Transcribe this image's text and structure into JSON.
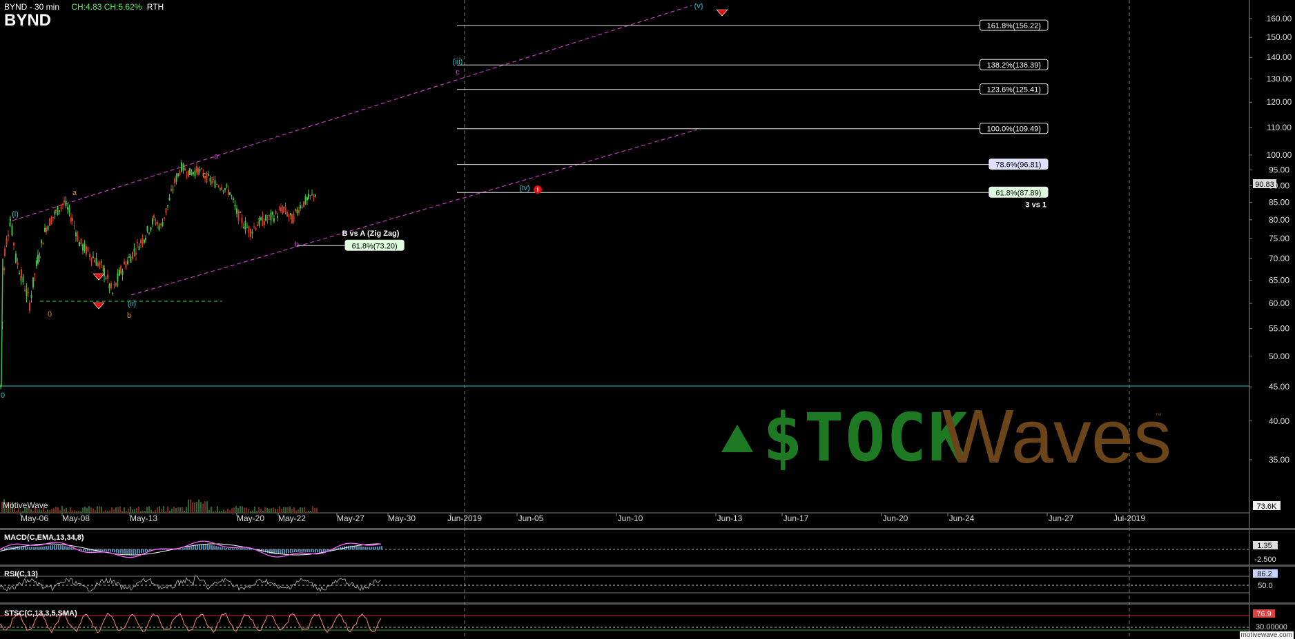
{
  "header": {
    "title": "BYND - 30 min",
    "change": "CH:4.83 CH:5.62%",
    "session": "RTH",
    "symbol": "BYND"
  },
  "vendor": "MotiveWave",
  "watermark": "motivewave.com",
  "logo": {
    "stock": "$TOCK",
    "waves": "Waves",
    "tm": "™"
  },
  "colors": {
    "background": "#000000",
    "bull": "#3fc43f",
    "bear": "#d83a1e",
    "channel": "#c23cc2",
    "fib": "#ffffff",
    "wave_cyan": "#2cc4d0",
    "wave_orange": "#e08a2a",
    "wave_magenta": "#d040d0",
    "macd_line": "#ff66ff",
    "macd_signal": "#ffffff",
    "macd_hist": "#5ab0e0",
    "rsi_line": "#bbbbbb",
    "stoch_line": "#ff8080",
    "logo_green": "#1d7a22",
    "logo_brown": "#6b4519"
  },
  "chart_data": {
    "type": "candlestick",
    "title": "BYND - 30 min",
    "x_ticks": [
      "May-06",
      "May-08",
      "May-13",
      "May-20",
      "May-22",
      "May-27",
      "May-30",
      "Jun-2019",
      "Jun-05",
      "Jun-10",
      "Jun-13",
      "Jun-17",
      "Jun-20",
      "Jun-24",
      "Jun-27",
      "Jul-2019"
    ],
    "y_ticks": [
      35,
      40,
      45,
      50,
      55,
      60,
      65,
      70,
      75,
      80,
      85,
      90,
      95,
      100,
      110,
      120,
      130,
      140,
      150,
      160
    ],
    "ylim": [
      32,
      164
    ],
    "y_scale": "log",
    "last_price": "90.83",
    "volume_label": "73.6K",
    "price_path": [
      [
        0,
        45
      ],
      [
        6,
        72
      ],
      [
        14,
        80
      ],
      [
        22,
        70
      ],
      [
        30,
        66
      ],
      [
        42,
        60
      ],
      [
        54,
        70
      ],
      [
        66,
        78
      ],
      [
        80,
        82
      ],
      [
        92,
        85
      ],
      [
        104,
        80
      ],
      [
        114,
        74
      ],
      [
        124,
        72
      ],
      [
        136,
        70
      ],
      [
        150,
        67
      ],
      [
        162,
        62
      ],
      [
        174,
        67
      ],
      [
        186,
        70
      ],
      [
        198,
        73
      ],
      [
        210,
        76
      ],
      [
        222,
        80
      ],
      [
        232,
        78
      ],
      [
        242,
        84
      ],
      [
        252,
        91
      ],
      [
        262,
        96
      ],
      [
        274,
        94
      ],
      [
        286,
        95
      ],
      [
        296,
        93
      ],
      [
        308,
        91
      ],
      [
        320,
        90
      ],
      [
        332,
        88
      ],
      [
        342,
        82
      ],
      [
        352,
        79
      ],
      [
        362,
        77
      ],
      [
        372,
        79
      ],
      [
        384,
        80
      ],
      [
        396,
        81
      ],
      [
        410,
        83
      ],
      [
        422,
        80
      ],
      [
        434,
        84
      ],
      [
        446,
        86
      ],
      [
        458,
        88
      ]
    ],
    "fib_levels": [
      {
        "label": "161.8%(156.22)",
        "value": 156.22
      },
      {
        "label": "138.2%(136.39)",
        "value": 136.39
      },
      {
        "label": "123.6%(125.41)",
        "value": 125.41
      },
      {
        "label": "100.0%(109.49)",
        "value": 109.49
      },
      {
        "label": "78.6%(96.81)",
        "value": 96.81
      },
      {
        "label": "61.8%(87.89)",
        "value": 87.89
      },
      {
        "label": "61.8%(73.20)",
        "value": 73.2
      }
    ],
    "annotations": [
      {
        "text": "3 vs 1"
      },
      {
        "text": "B vs A (Zig Zag)"
      }
    ],
    "wave_labels": [
      {
        "text": "(i)",
        "color": "wave_cyan"
      },
      {
        "text": "a",
        "color": "wave_orange"
      },
      {
        "text": "0",
        "color": "wave_orange"
      },
      {
        "text": "b",
        "color": "wave_orange"
      },
      {
        "text": "(ii)",
        "color": "wave_cyan"
      },
      {
        "text": "c",
        "color": "wave_orange"
      },
      {
        "text": "a",
        "color": "wave_magenta"
      },
      {
        "text": "b",
        "color": "wave_magenta"
      },
      {
        "text": "(iii)",
        "color": "wave_cyan"
      },
      {
        "text": "c",
        "color": "wave_magenta"
      },
      {
        "text": "(iv)",
        "color": "wave_cyan"
      },
      {
        "text": "(v)",
        "color": "wave_cyan"
      },
      {
        "text": "0",
        "color": "wave_cyan"
      }
    ],
    "indicators": [
      {
        "name": "MACD(C,EMA,13,34,8)",
        "scale": [
          "1.35",
          "-2.500"
        ]
      },
      {
        "name": "RSI(C,13)",
        "scale": [
          "86.2",
          "50.0"
        ]
      },
      {
        "name": "STSC(C,13,3,5,SMA)",
        "scale": [
          "76.9",
          "30.00000"
        ]
      }
    ]
  }
}
